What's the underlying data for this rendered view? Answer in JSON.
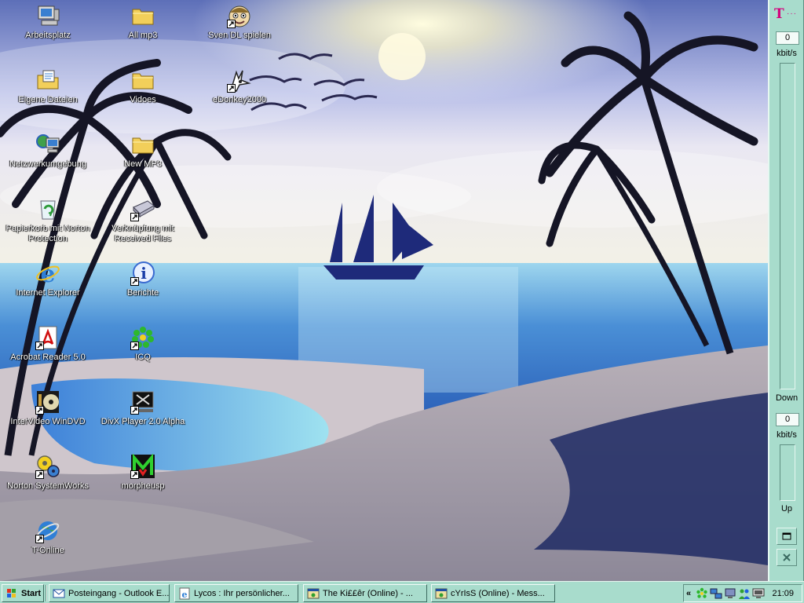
{
  "desktop": {
    "icons": [
      {
        "label": "Arbeitsplatz",
        "icon": "my-computer-icon"
      },
      {
        "label": "Eigene Dateien",
        "icon": "my-documents-icon"
      },
      {
        "label": "Netzwerkumgebung",
        "icon": "network-icon"
      },
      {
        "label": "Papierkorb mit Norton Protection",
        "icon": "recycle-bin-icon"
      },
      {
        "label": "Internet Explorer",
        "icon": "internet-explorer-icon"
      },
      {
        "label": "Acrobat Reader 5.0",
        "icon": "acrobat-icon"
      },
      {
        "label": "InterVideo WinDVD",
        "icon": "windvd-icon"
      },
      {
        "label": "Norton SystemWorks",
        "icon": "norton-icon"
      },
      {
        "label": "T-Online",
        "icon": "t-online-icon"
      },
      {
        "label": "All mp3",
        "icon": "folder-icon"
      },
      {
        "label": "Vidoes",
        "icon": "folder-icon"
      },
      {
        "label": "New MP3",
        "icon": "folder-icon"
      },
      {
        "label": "Verknüpfung mit Received Files",
        "icon": "drive-shortcut-icon"
      },
      {
        "label": "Berichte",
        "icon": "info-icon"
      },
      {
        "label": "ICQ",
        "icon": "icq-flower-icon"
      },
      {
        "label": "DivX Player 2.0 Alpha",
        "icon": "divx-icon"
      },
      {
        "label": "morpheusp",
        "icon": "morpheus-icon"
      },
      {
        "label": "Sven DL spielen",
        "icon": "cartoon-face-icon"
      },
      {
        "label": "eDonkey2000",
        "icon": "edonkey-icon"
      }
    ]
  },
  "meter": {
    "logo": "T",
    "logo_dots": "···",
    "down_value": "0",
    "down_unit": "kbit/s",
    "down_label": "Down",
    "up_value": "0",
    "up_unit": "kbit/s",
    "up_label": "Up"
  },
  "taskbar": {
    "start_label": "Start",
    "tasks": [
      {
        "label": "Posteingang - Outlook E...",
        "icon": "outlook-icon"
      },
      {
        "label": "Lycos : Ihr persönlicher...",
        "icon": "ie-page-icon"
      },
      {
        "label": "The Ki££êr (Online) - ...",
        "icon": "messenger-icon"
      },
      {
        "label": "cYrIsS (Online) - Mess...",
        "icon": "messenger-icon"
      }
    ],
    "tray": {
      "chevron": "«",
      "icons": [
        "icq-tray-icon",
        "network-tray-icon",
        "monitor-tray-icon",
        "people-tray-icon",
        "display-tray-icon"
      ],
      "clock": "21:09"
    }
  },
  "colors": {
    "taskbar_bg": "#a8dccc",
    "telekom_magenta": "#d3007c"
  }
}
